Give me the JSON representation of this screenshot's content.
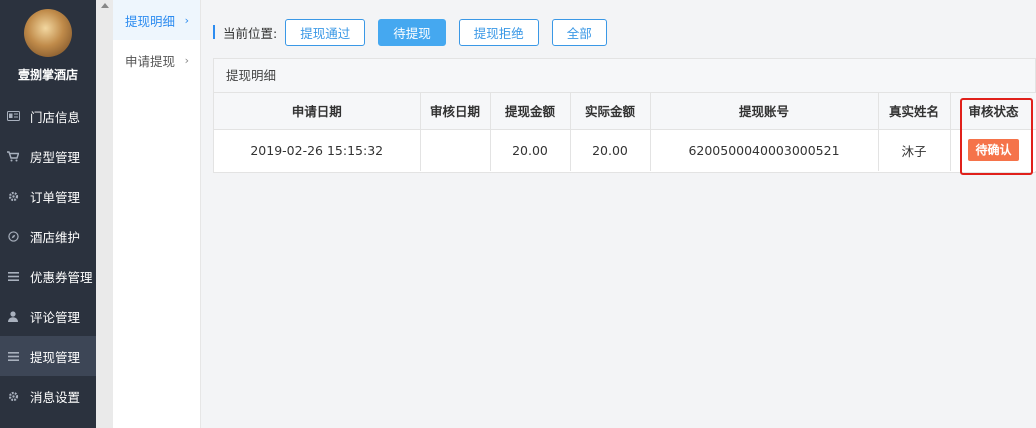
{
  "sidebar": {
    "hotel_name": "壹捌掌酒店",
    "items": [
      {
        "label": "门店信息",
        "icon": "id-card-icon"
      },
      {
        "label": "房型管理",
        "icon": "cart-icon"
      },
      {
        "label": "订单管理",
        "icon": "gear-icon"
      },
      {
        "label": "酒店维护",
        "icon": "compass-icon"
      },
      {
        "label": "优惠券管理",
        "icon": "list-icon"
      },
      {
        "label": "评论管理",
        "icon": "user-icon"
      },
      {
        "label": "提现管理",
        "icon": "list-icon"
      },
      {
        "label": "消息设置",
        "icon": "gear-icon"
      }
    ]
  },
  "subnav": {
    "items": [
      {
        "label": "提现明细"
      },
      {
        "label": "申请提现"
      }
    ]
  },
  "toolbar": {
    "location_label": "当前位置:",
    "buttons": [
      "提现通过",
      "待提现",
      "提现拒绝",
      "全部"
    ]
  },
  "panel": {
    "title": "提现明细",
    "columns": [
      "申请日期",
      "审核日期",
      "提现金额",
      "实际金额",
      "提现账号",
      "真实姓名",
      "审核状态"
    ],
    "rows": [
      {
        "apply_date": "2019-02-26 15:15:32",
        "review_date": "",
        "amount": "20.00",
        "actual_amount": "20.00",
        "account": "6200500040003000521",
        "real_name": "沐子",
        "status": "待确认"
      }
    ]
  },
  "colors": {
    "sidebar_bg": "#2b323e",
    "accent": "#3a98e6",
    "status_badge": "#f5734a",
    "highlight": "#e0201b"
  }
}
